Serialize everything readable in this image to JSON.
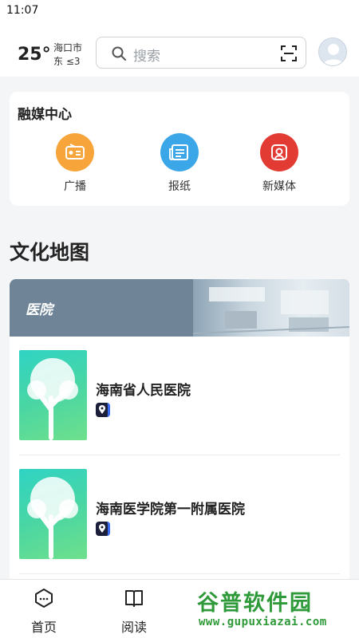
{
  "status_bar": {
    "time": "11:07"
  },
  "weather": {
    "temperature": "25°",
    "city": "海口市",
    "wind": "东 ≤3"
  },
  "search": {
    "placeholder": "搜索"
  },
  "media_center": {
    "title": "融媒中心",
    "items": [
      {
        "label": "广播",
        "icon": "radio-icon",
        "color": "#f7a53a"
      },
      {
        "label": "报纸",
        "icon": "newspaper-icon",
        "color": "#3ba7e8"
      },
      {
        "label": "新媒体",
        "icon": "new-media-icon",
        "color": "#e23b33"
      }
    ]
  },
  "culture_map": {
    "title": "文化地图",
    "category": "医院",
    "places": [
      {
        "name": "海南省人民医院"
      },
      {
        "name": "海南医学院第一附属医院"
      }
    ]
  },
  "bottom_nav": {
    "items": [
      {
        "label": "首页",
        "icon": "home-icon"
      },
      {
        "label": "阅读",
        "icon": "book-icon"
      }
    ]
  },
  "watermark": {
    "text": "谷普软件园",
    "url": "www.gupuxiazai.com"
  }
}
